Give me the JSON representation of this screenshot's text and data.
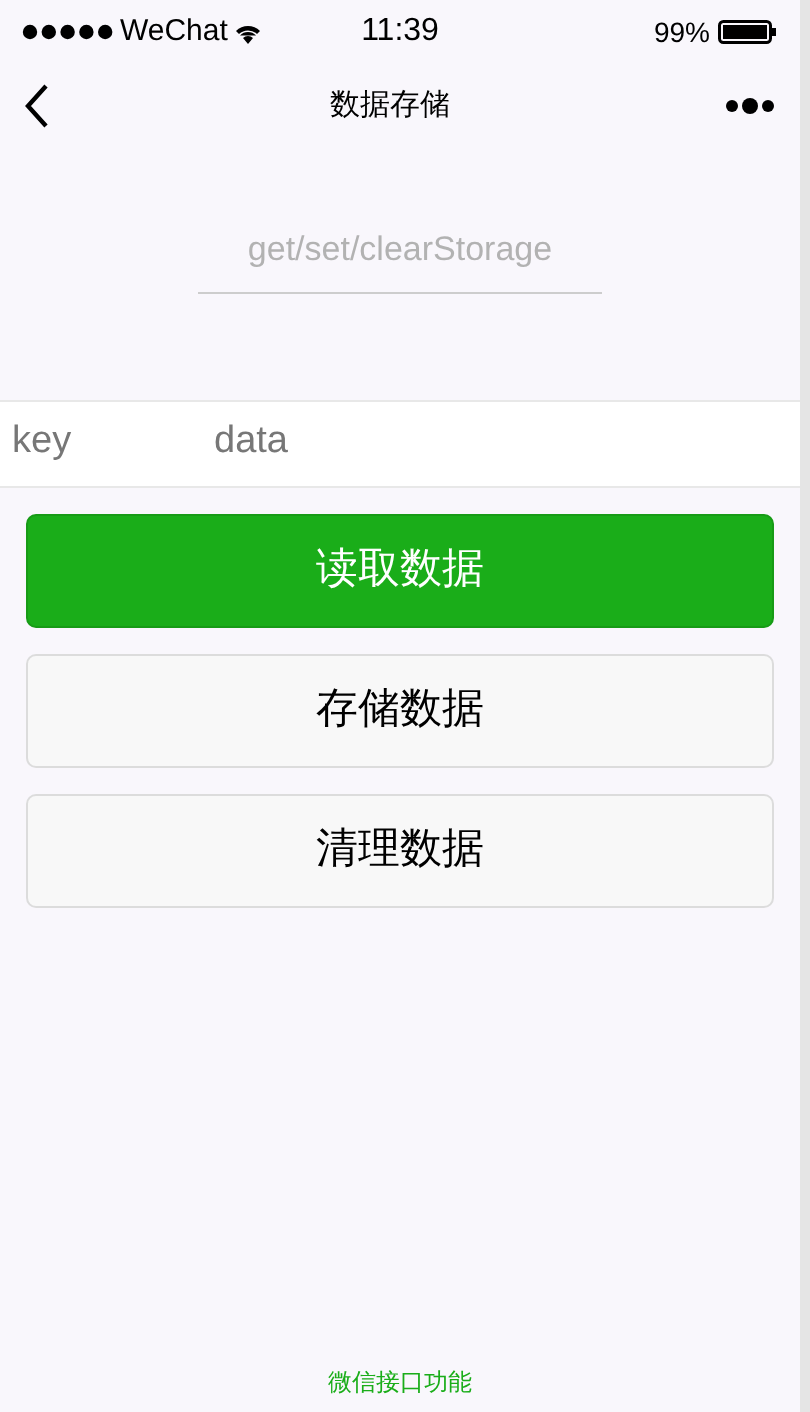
{
  "status_bar": {
    "carrier": "WeChat",
    "time": "11:39",
    "battery": "99%"
  },
  "nav_bar": {
    "title": "数据存储"
  },
  "header": {
    "text": "get/set/clearStorage"
  },
  "fields": [
    {
      "placeholder": "key"
    },
    {
      "placeholder": "data"
    }
  ],
  "buttons": [
    {
      "label": "读取数据",
      "kind": "primary"
    },
    {
      "label": "存储数据",
      "kind": "default"
    },
    {
      "label": "清理数据",
      "kind": "default"
    }
  ],
  "footer": {
    "text": "微信接口功能"
  }
}
